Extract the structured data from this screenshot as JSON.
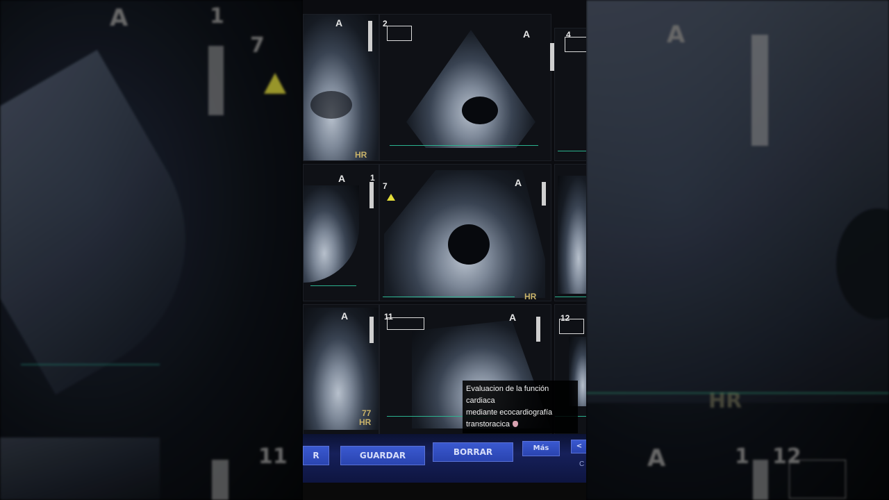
{
  "side_left": {
    "letter": "A",
    "numbers": [
      "1",
      "7",
      "11"
    ]
  },
  "side_right": {
    "letters": [
      "A",
      "A"
    ],
    "numbers": [
      "1",
      "12"
    ],
    "hr": "HR"
  },
  "echo_grid": {
    "rows": [
      {
        "cells": [
          {
            "label": "A",
            "num": "",
            "hr": "HR"
          },
          {
            "label": "A",
            "num": "2",
            "hr": ""
          },
          {
            "label": "",
            "num": "4",
            "hr": ""
          }
        ]
      },
      {
        "cells": [
          {
            "label": "A",
            "num": "1",
            "hr": ""
          },
          {
            "label": "A",
            "num": "7",
            "hr": "HR"
          },
          {
            "label": "",
            "num": "",
            "hr": ""
          }
        ]
      },
      {
        "cells": [
          {
            "label": "A",
            "num": "",
            "hr_value": "77",
            "hr": "HR"
          },
          {
            "label": "A",
            "num": "11",
            "hr": ""
          },
          {
            "label": "",
            "num": "12",
            "hr": ""
          }
        ]
      }
    ]
  },
  "buttons": {
    "left_partial": "R",
    "save": "GUARDAR",
    "delete": "BORRAR",
    "more": "Más",
    "right_partial": "<",
    "edge": "C"
  },
  "caption": {
    "line1": "Evaluacion de la función cardiaca",
    "line2": "mediante ecocardiografía",
    "line3": "transtoracica"
  },
  "colors": {
    "button_blue": "#2a44b0",
    "ecg_green": "#2bb38f",
    "marker_yellow": "#e3dc3a",
    "hr_text": "#c9b36a"
  }
}
